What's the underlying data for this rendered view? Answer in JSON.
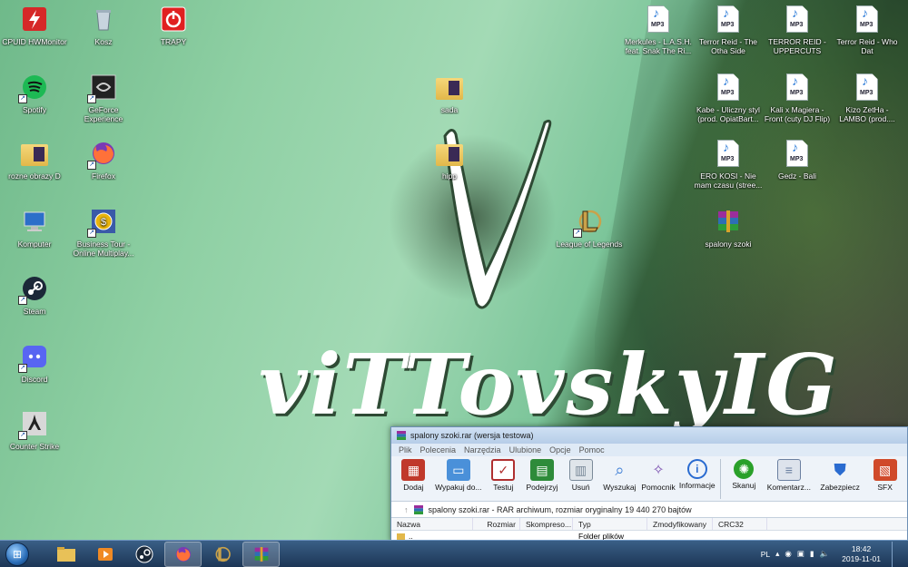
{
  "desktop": {
    "icons_left": [
      {
        "label": "CPUID HWMonitor",
        "icon": "hwmonitor-icon",
        "color": "#d62828"
      },
      {
        "label": "Spotify",
        "icon": "spotify-icon",
        "color": "#1db954"
      },
      {
        "label": "rozne obrazy D",
        "icon": "folder-icon",
        "color": "#e8c158"
      },
      {
        "label": "Komputer",
        "icon": "computer-icon",
        "color": "#3a86d4"
      },
      {
        "label": "Steam",
        "icon": "steam-icon",
        "color": "#1b2838"
      },
      {
        "label": "Discord",
        "icon": "discord-icon",
        "color": "#5865f2"
      },
      {
        "label": "Counter Strike",
        "icon": "counter-strike-icon",
        "color": "#8a8a8a"
      }
    ],
    "icons_second": [
      {
        "label": "Kosz",
        "icon": "recycle-bin-icon",
        "color": "#b7c4cf"
      },
      {
        "label": "GeForce Experience",
        "icon": "geforce-icon",
        "color": "#222222"
      },
      {
        "label": "Firefox",
        "icon": "firefox-icon",
        "color": "#ff7139"
      },
      {
        "label": "Business Tour - Online Multiplay...",
        "icon": "business-tour-icon",
        "color": "#e9b40c"
      }
    ],
    "icon_trapy": {
      "label": "TRAPY",
      "icon": "power-icon",
      "color": "#e02020"
    },
    "icons_middle": [
      {
        "label": "sada",
        "icon": "folder-icon"
      },
      {
        "label": "hipp",
        "icon": "folder-icon"
      },
      {
        "label": "League of Legends",
        "icon": "league-icon"
      }
    ],
    "mp3_files": [
      {
        "label": "Merkules - L.A.S.H. feat. Snak The Ri..."
      },
      {
        "label": "Terror Reid - The Otha Side"
      },
      {
        "label": "TERROR REID - UPPERCUTS"
      },
      {
        "label": "Terror Reid - Who Dat"
      },
      {
        "label": "Kabe - Uliczny styl (prod. OpiatBart..."
      },
      {
        "label": "Kali x Magiera - Front (cuty DJ Flip)"
      },
      {
        "label": "Kizo  ZetHa - LAMBO (prod...."
      },
      {
        "label": "ERO KOSI - Nie mam czasu (stree..."
      },
      {
        "label": "Gedz - Bali"
      }
    ],
    "mp3_tag": "MP3",
    "archive_icon": {
      "label": "spalony szoki"
    },
    "wallpaper_text": "viTTovskyIG"
  },
  "winrar": {
    "title": "spalony szoki.rar (wersja testowa)",
    "menu": [
      "Plik",
      "Polecenia",
      "Narzędzia",
      "Ulubione",
      "Opcje",
      "Pomoc"
    ],
    "tools": [
      {
        "label": "Dodaj",
        "icon": "add-archive-icon",
        "color": "#c0392b"
      },
      {
        "label": "Wypakuj do...",
        "icon": "extract-folder-icon",
        "color": "#4a90d9"
      },
      {
        "label": "Testuj",
        "icon": "test-clipboard-icon",
        "color": "#b03030"
      },
      {
        "label": "Podejrzyj",
        "icon": "view-book-icon",
        "color": "#2e8b3a"
      },
      {
        "label": "Usuń",
        "icon": "delete-bin-icon",
        "color": "#7a8a99"
      },
      {
        "label": "Wyszukaj",
        "icon": "find-magnifier-icon",
        "color": "#3a7bd5"
      },
      {
        "label": "Pomocnik",
        "icon": "wizard-wand-icon",
        "color": "#7b4fb0"
      },
      {
        "label": "Informacje",
        "icon": "info-icon",
        "color": "#2a6bd0"
      },
      {
        "label": "Skanuj",
        "icon": "scan-virus-icon",
        "color": "#2aa02a"
      },
      {
        "label": "Komentarz...",
        "icon": "comment-icon",
        "color": "#6a7fa0"
      },
      {
        "label": "Zabezpiecz",
        "icon": "protect-shield-icon",
        "color": "#2a6bd0"
      },
      {
        "label": "SFX",
        "icon": "sfx-icon",
        "color": "#d04a2a"
      }
    ],
    "address": "spalony szoki.rar - RAR archiwum, rozmiar oryginalny 19 440 270 bajtów",
    "columns": [
      "Nazwa",
      "Rozmiar",
      "Skompreso...",
      "Typ",
      "Zmodyfikowany",
      "CRC32"
    ],
    "rows": [
      {
        "name": "..",
        "size": "",
        "packed": "",
        "type": "Folder plików",
        "modified": "",
        "crc": ""
      }
    ]
  },
  "taskbar": {
    "apps": [
      {
        "name": "explorer",
        "icon": "folder-icon",
        "color": "#e8c158",
        "active": false
      },
      {
        "name": "media-player",
        "icon": "media-player-icon",
        "color": "#f08a24",
        "active": false
      },
      {
        "name": "steam",
        "icon": "steam-icon",
        "color": "#1b2838",
        "active": false
      },
      {
        "name": "firefox",
        "icon": "firefox-icon",
        "color": "#ff7139",
        "active": true
      },
      {
        "name": "league",
        "icon": "league-icon",
        "color": "#c9a24a",
        "active": false
      },
      {
        "name": "winrar",
        "icon": "winrar-icon",
        "color": "#8e2a8e",
        "active": true
      }
    ],
    "language": "PL",
    "time": "18:42",
    "date": "2019-11-01"
  }
}
